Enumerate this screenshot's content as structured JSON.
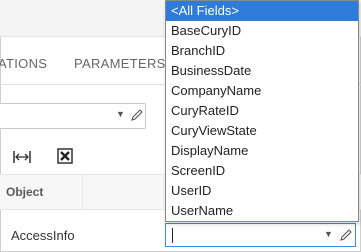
{
  "tabs": [
    {
      "label": "ATIONS"
    },
    {
      "label": "PARAMETERS"
    }
  ],
  "grid": {
    "header_object": "Object",
    "row_object": "AccessInfo"
  },
  "field_dropdown": {
    "selected": "<All Fields>",
    "options": [
      "<All Fields>",
      "BaseCuryID",
      "BranchID",
      "BusinessDate",
      "CompanyName",
      "CuryRateID",
      "CuryViewState",
      "DisplayName",
      "ScreenID",
      "UserID",
      "UserName"
    ]
  },
  "field_input": {
    "value": ""
  },
  "icons": {
    "fit_columns": "fit-columns-icon",
    "export_excel": "excel-export-icon",
    "dropdown_arrow": "chevron-down-icon",
    "edit": "pencil-icon"
  },
  "colors": {
    "selection": "#2f7bd9",
    "focus_border": "#3a8de0"
  }
}
